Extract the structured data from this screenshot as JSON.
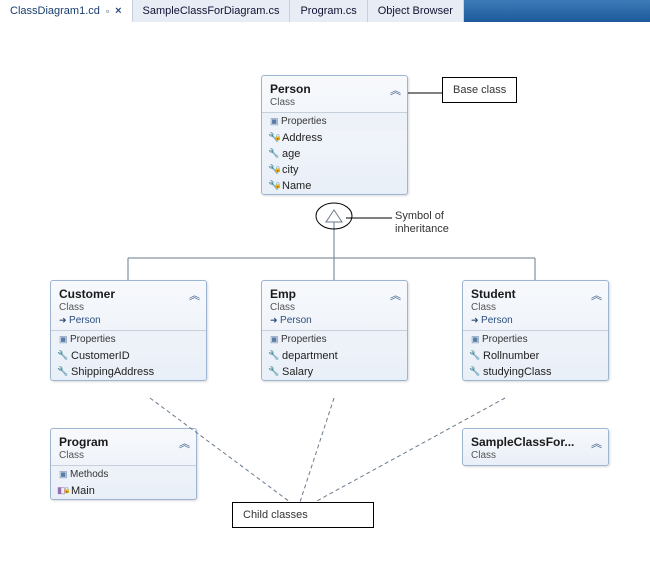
{
  "tabs": [
    {
      "label": "ClassDiagram1.cd"
    },
    {
      "label": "SampleClassForDiagram.cs"
    },
    {
      "label": "Program.cs"
    },
    {
      "label": "Object Browser"
    }
  ],
  "labels": {
    "properties": "Properties",
    "methods": "Methods"
  },
  "classes": {
    "person": {
      "name": "Person",
      "kind": "Class",
      "props": [
        "Address",
        "age",
        "city",
        "Name"
      ]
    },
    "customer": {
      "name": "Customer",
      "kind": "Class",
      "parent": "Person",
      "props": [
        "CustomerID",
        "ShippingAddress"
      ]
    },
    "emp": {
      "name": "Emp",
      "kind": "Class",
      "parent": "Person",
      "props": [
        "department",
        "Salary"
      ]
    },
    "student": {
      "name": "Student",
      "kind": "Class",
      "parent": "Person",
      "props": [
        "Rollnumber",
        "studyingClass"
      ]
    },
    "program": {
      "name": "Program",
      "kind": "Class",
      "methods": [
        "Main"
      ]
    },
    "sample": {
      "name": "SampleClassFor...",
      "kind": "Class"
    }
  },
  "notes": {
    "base": "Base class",
    "child": "Child classes",
    "inheritance1": "Symbol of",
    "inheritance2": "inheritance"
  }
}
